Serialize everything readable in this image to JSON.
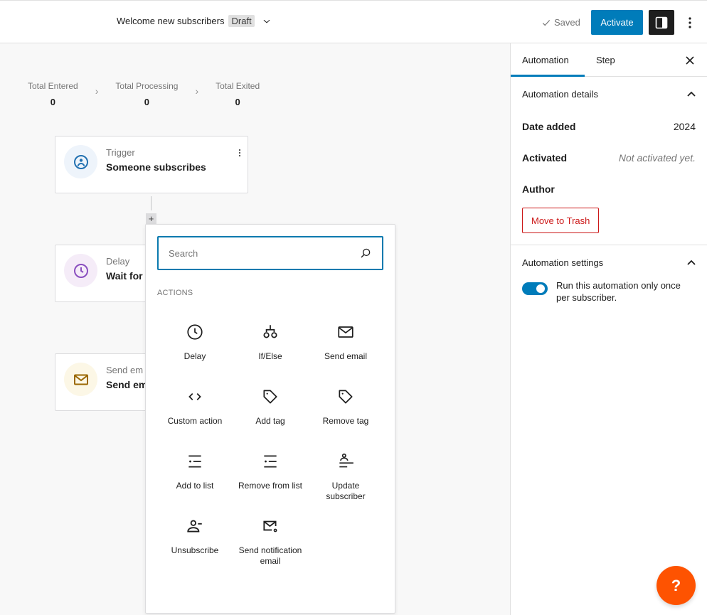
{
  "header": {
    "title": "Welcome new subscribers",
    "status_badge": "Draft",
    "saved_label": "Saved",
    "activate_label": "Activate"
  },
  "stats": [
    {
      "label": "Total Entered",
      "value": "0"
    },
    {
      "label": "Total Processing",
      "value": "0"
    },
    {
      "label": "Total Exited",
      "value": "0"
    }
  ],
  "steps": [
    {
      "type": "Trigger",
      "name": "Someone subscribes",
      "icon": "user-circle-icon",
      "color": "#2271b1",
      "bg": "#eef4fb"
    },
    {
      "type": "Delay",
      "name": "Wait for",
      "icon": "clock-icon",
      "color": "#8a4fbf",
      "bg": "#f5ecf8"
    },
    {
      "type": "Send em",
      "name": "Send em",
      "icon": "envelope-icon",
      "color": "#9a6700",
      "bg": "#fcf7e6"
    }
  ],
  "popover": {
    "search_placeholder": "Search",
    "search_value": "",
    "actions_heading": "ACTIONS",
    "actions": [
      {
        "label": "Delay",
        "icon": "clock-icon"
      },
      {
        "label": "If/Else",
        "icon": "branch-icon"
      },
      {
        "label": "Send email",
        "icon": "envelope-icon"
      },
      {
        "label": "Custom action",
        "icon": "code-icon"
      },
      {
        "label": "Add tag",
        "icon": "tag-icon"
      },
      {
        "label": "Remove tag",
        "icon": "tag-icon"
      },
      {
        "label": "Add to list",
        "icon": "list-icon"
      },
      {
        "label": "Remove from list",
        "icon": "list-icon"
      },
      {
        "label": "Update subscriber",
        "icon": "user-update-icon"
      },
      {
        "label": "Unsubscribe",
        "icon": "user-minus-icon"
      },
      {
        "label": "Send notification email",
        "icon": "envelope-gear-icon"
      }
    ]
  },
  "sidebar": {
    "tabs": [
      {
        "label": "Automation",
        "active": true
      },
      {
        "label": "Step",
        "active": false
      }
    ],
    "details": {
      "heading": "Automation details",
      "date_added_label": "Date added",
      "date_added_value": "2024",
      "activated_label": "Activated",
      "activated_value": "Not activated yet.",
      "author_label": "Author",
      "trash_label": "Move to Trash"
    },
    "settings": {
      "heading": "Automation settings",
      "run_once_label": "Run this automation only once per subscriber.",
      "run_once_enabled": true
    }
  },
  "help_label": "?",
  "colors": {
    "accent": "#007cba",
    "danger": "#cc1818",
    "help": "#fe5301"
  }
}
